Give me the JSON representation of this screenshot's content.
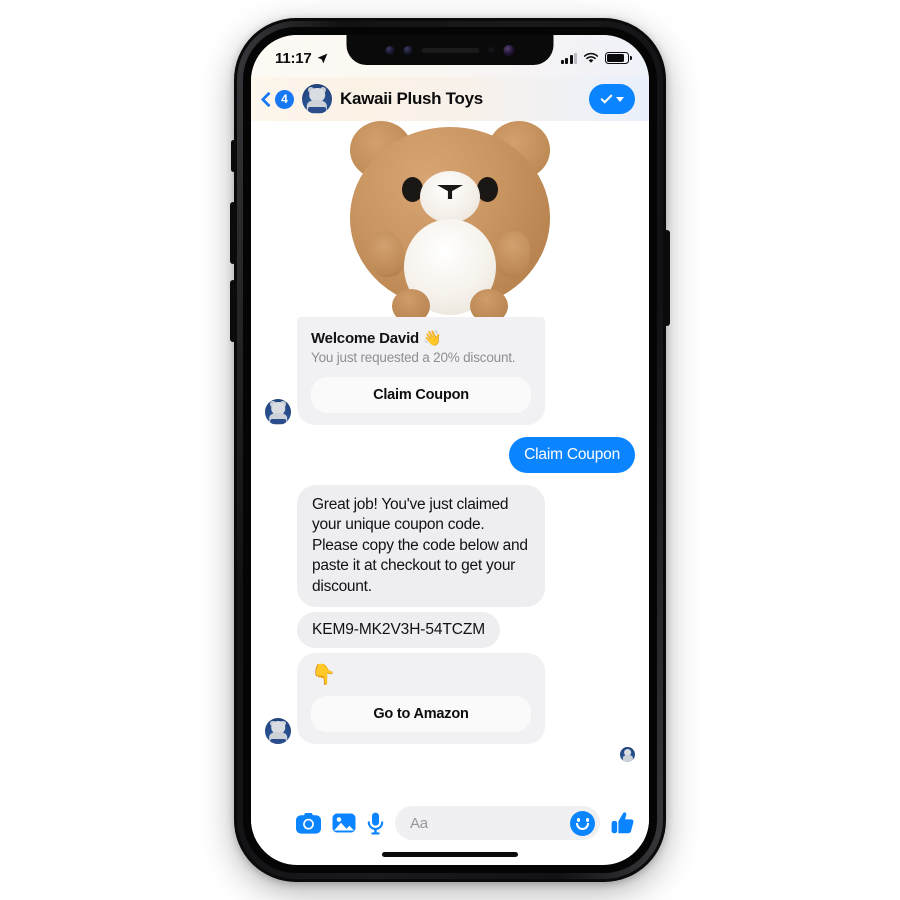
{
  "status_bar": {
    "time": "11:17",
    "location_icon": "location-arrow-icon",
    "signal_icon": "cellular-signal-icon",
    "wifi_icon": "wifi-icon",
    "battery_icon": "battery-icon"
  },
  "header": {
    "back_icon": "back-chevron-icon",
    "unread_badge": "4",
    "avatar_name": "kawaii-plush-toys-avatar",
    "title": "Kawaii Plush Toys",
    "verified_icon": "checkmark-icon",
    "dropdown_icon": "caret-down-icon"
  },
  "conversation": {
    "hero_image_alt": "brown-teddy-bear-plush-photo",
    "welcome_card": {
      "title": "Welcome David 👋",
      "subtitle": "You just requested a 20% discount.",
      "button_label": "Claim Coupon"
    },
    "outgoing_message": "Claim Coupon",
    "incoming_message": "Great job! You've just claimed your unique coupon code. Please copy the code below and paste it at checkout to get your discount.",
    "coupon_code": "KEM9-MK2V3H-54TCZM",
    "amazon_card": {
      "emoji": "👇",
      "button_label": "Go to Amazon"
    },
    "read_receipt_alt": "seen-avatar"
  },
  "input_bar": {
    "apps_icon": "four-dot-grid-icon",
    "camera_icon": "camera-icon",
    "gallery_icon": "photo-gallery-icon",
    "mic_icon": "microphone-icon",
    "placeholder": "Aa",
    "emoji_icon": "smiley-face-icon",
    "like_icon": "thumbs-up-icon"
  },
  "colors": {
    "accent_blue": "#0a84ff",
    "brand_blue": "#1877f2",
    "bubble_gray": "#eeeef0",
    "card_gray": "#f1f1f3",
    "muted_text": "#8e8e93"
  }
}
